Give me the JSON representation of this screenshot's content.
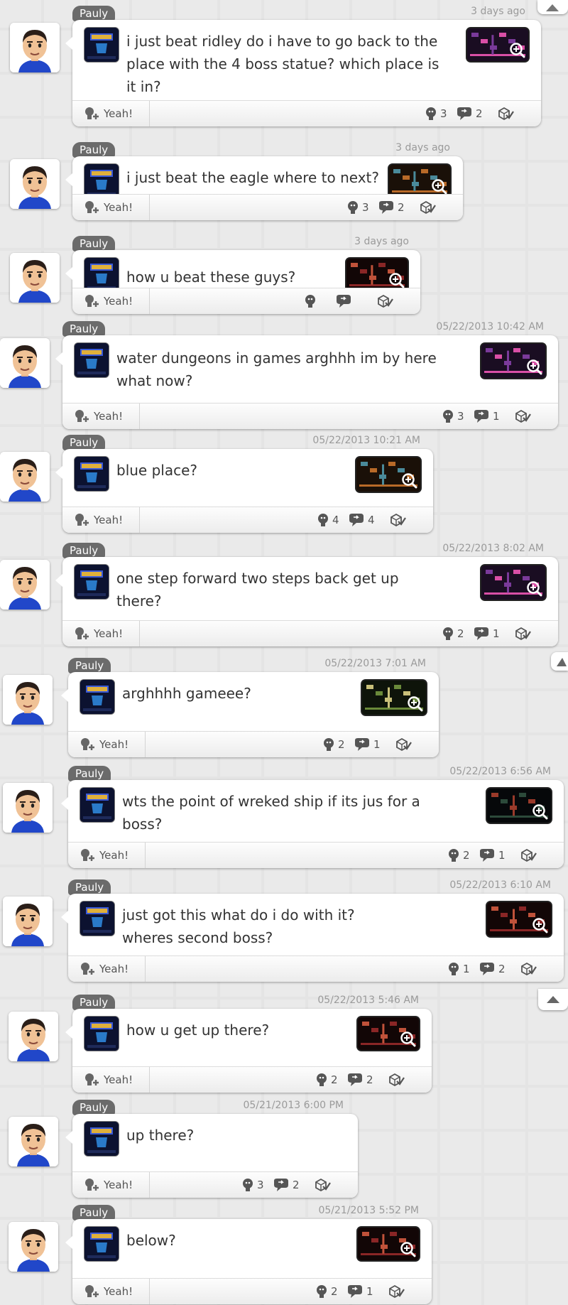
{
  "colors": {
    "name_tab": "#6b6b6b",
    "timestamp": "#9a9a9a",
    "text": "#333333",
    "card": "#ffffff"
  },
  "posts": [
    {
      "username": "Pauly",
      "time": "3 days ago",
      "text": "i just beat ridley do i have to go back to the\nplace with the 4 boss statue? which place is\nit in?",
      "yeah_label": "Yeah!",
      "yeahs": "3",
      "comments": "2",
      "spoiler_icon": "played-check-icon",
      "screenshot": "map-pink"
    },
    {
      "username": "Pauly",
      "time": "3 days ago",
      "text": "i just beat the eagle where to next?",
      "yeah_label": "Yeah!",
      "yeahs": "3",
      "comments": "2",
      "screenshot": "room-orange"
    },
    {
      "username": "Pauly",
      "time": "3 days ago",
      "text": "how u beat these guys?",
      "yeah_label": "Yeah!",
      "yeahs": "",
      "comments": "",
      "screenshot": "room-red"
    },
    {
      "username": "Pauly",
      "time": "05/22/2013 10:42 AM",
      "text": "water dungeons in games arghhh im by here\nwhat now?",
      "yeah_label": "Yeah!",
      "yeahs": "3",
      "comments": "1",
      "screenshot": "map-pink"
    },
    {
      "username": "Pauly",
      "time": "05/22/2013 10:21 AM",
      "text": "blue place?",
      "yeah_label": "Yeah!",
      "yeahs": "4",
      "comments": "4",
      "screenshot": "room-orange"
    },
    {
      "username": "Pauly",
      "time": "05/22/2013 8:02 AM",
      "text": "one step forward two steps back get up\nthere?",
      "yeah_label": "Yeah!",
      "yeahs": "2",
      "comments": "1",
      "screenshot": "map-pink"
    },
    {
      "username": "Pauly",
      "time": "05/22/2013 7:01 AM",
      "text": "arghhhh gameee?",
      "yeah_label": "Yeah!",
      "yeahs": "2",
      "comments": "1",
      "screenshot": "room-green"
    },
    {
      "username": "Pauly",
      "time": "05/22/2013 6:56 AM",
      "text": "wts the point of wreked ship if its jus for a\nboss?",
      "yeah_label": "Yeah!",
      "yeahs": "2",
      "comments": "1",
      "screenshot": "room-dark"
    },
    {
      "username": "Pauly",
      "time": "05/22/2013 6:10 AM",
      "text": "just got this what do i do with it?\nwheres second boss?",
      "yeah_label": "Yeah!",
      "yeahs": "1",
      "comments": "2",
      "screenshot": "room-red"
    },
    {
      "username": "Pauly",
      "time": "05/22/2013 5:46 AM",
      "text": "how u get up there?",
      "yeah_label": "Yeah!",
      "yeahs": "2",
      "comments": "2",
      "screenshot": "room-red"
    },
    {
      "username": "Pauly",
      "time": "05/21/2013 6:00 PM",
      "text": "up there?",
      "yeah_label": "Yeah!",
      "yeahs": "3",
      "comments": "2",
      "screenshot": ""
    },
    {
      "username": "Pauly",
      "time": "05/21/2013 5:52 PM",
      "text": "below?",
      "yeah_label": "Yeah!",
      "yeahs": "2",
      "comments": "1",
      "screenshot": "room-red"
    }
  ]
}
